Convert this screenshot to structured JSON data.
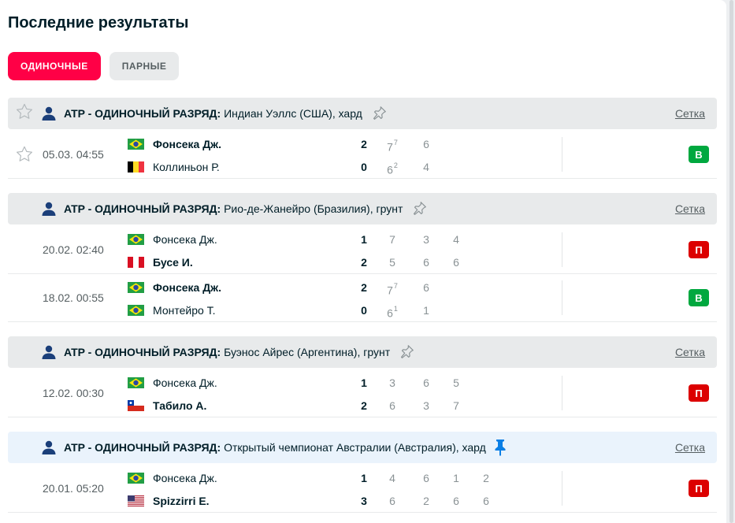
{
  "title": "Последние результаты",
  "tabs": [
    {
      "label": "ОДИНОЧНЫЕ",
      "active": true
    },
    {
      "label": "ПАРНЫЕ",
      "active": false
    }
  ],
  "colors": {
    "accent": "#ff0046",
    "win": "#00a83f",
    "loss": "#dc0000",
    "pin_active": "#0b7fe5"
  },
  "leagues": [
    {
      "category": "ATP - ОДИНОЧНЫЙ РАЗРЯД:",
      "name": "Индиан Уэллс (США), хард",
      "draw_label": "Сетка",
      "pinned": false,
      "matches": [
        {
          "time": "05.03. 04:55",
          "result": "В",
          "p1": {
            "name": "Фонсека Дж.",
            "flag": "brazil-flag",
            "winner": true,
            "total": "2",
            "sets": [
              "7",
              "6"
            ],
            "tb": [
              "7",
              ""
            ]
          },
          "p2": {
            "name": "Коллиньон Р.",
            "flag": "belgium-flag",
            "winner": false,
            "total": "0",
            "sets": [
              "6",
              "4"
            ],
            "tb": [
              "2",
              ""
            ]
          }
        }
      ]
    },
    {
      "category": "ATP - ОДИНОЧНЫЙ РАЗРЯД:",
      "name": "Рио-де-Жанейро (Бразилия), грунт",
      "draw_label": "Сетка",
      "pinned": false,
      "matches": [
        {
          "time": "20.02. 02:40",
          "result": "П",
          "p1": {
            "name": "Фонсека Дж.",
            "flag": "brazil-flag",
            "winner": false,
            "total": "1",
            "sets": [
              "7",
              "3",
              "4"
            ],
            "tb": [
              "",
              "",
              ""
            ]
          },
          "p2": {
            "name": "Бусе И.",
            "flag": "peru-flag",
            "winner": true,
            "total": "2",
            "sets": [
              "5",
              "6",
              "6"
            ],
            "tb": [
              "",
              "",
              ""
            ]
          }
        },
        {
          "time": "18.02. 00:55",
          "result": "В",
          "p1": {
            "name": "Фонсека Дж.",
            "flag": "brazil-flag",
            "winner": true,
            "total": "2",
            "sets": [
              "7",
              "6"
            ],
            "tb": [
              "7",
              ""
            ]
          },
          "p2": {
            "name": "Монтейро Т.",
            "flag": "brazil-flag",
            "winner": false,
            "total": "0",
            "sets": [
              "6",
              "1"
            ],
            "tb": [
              "1",
              ""
            ]
          }
        }
      ]
    },
    {
      "category": "ATP - ОДИНОЧНЫЙ РАЗРЯД:",
      "name": "Буэнос Айрес (Аргентина), грунт",
      "draw_label": "Сетка",
      "pinned": false,
      "matches": [
        {
          "time": "12.02. 00:30",
          "result": "П",
          "p1": {
            "name": "Фонсека Дж.",
            "flag": "brazil-flag",
            "winner": false,
            "total": "1",
            "sets": [
              "3",
              "6",
              "5"
            ],
            "tb": [
              "",
              "",
              ""
            ]
          },
          "p2": {
            "name": "Табило А.",
            "flag": "chile-flag",
            "winner": true,
            "total": "2",
            "sets": [
              "6",
              "3",
              "7"
            ],
            "tb": [
              "",
              "",
              ""
            ]
          }
        }
      ]
    },
    {
      "category": "ATP - ОДИНОЧНЫЙ РАЗРЯД:",
      "name": "Открытый чемпионат Австралии (Австралия), хард",
      "draw_label": "Сетка",
      "pinned": true,
      "matches": [
        {
          "time": "20.01. 05:20",
          "result": "П",
          "p1": {
            "name": "Фонсека Дж.",
            "flag": "brazil-flag",
            "winner": false,
            "total": "1",
            "sets": [
              "4",
              "6",
              "1",
              "2"
            ],
            "tb": [
              "",
              "",
              "",
              ""
            ]
          },
          "p2": {
            "name": "Spizzirri E.",
            "flag": "usa-flag",
            "winner": true,
            "total": "3",
            "sets": [
              "6",
              "2",
              "6",
              "6"
            ],
            "tb": [
              "",
              "",
              "",
              ""
            ]
          }
        }
      ]
    }
  ]
}
